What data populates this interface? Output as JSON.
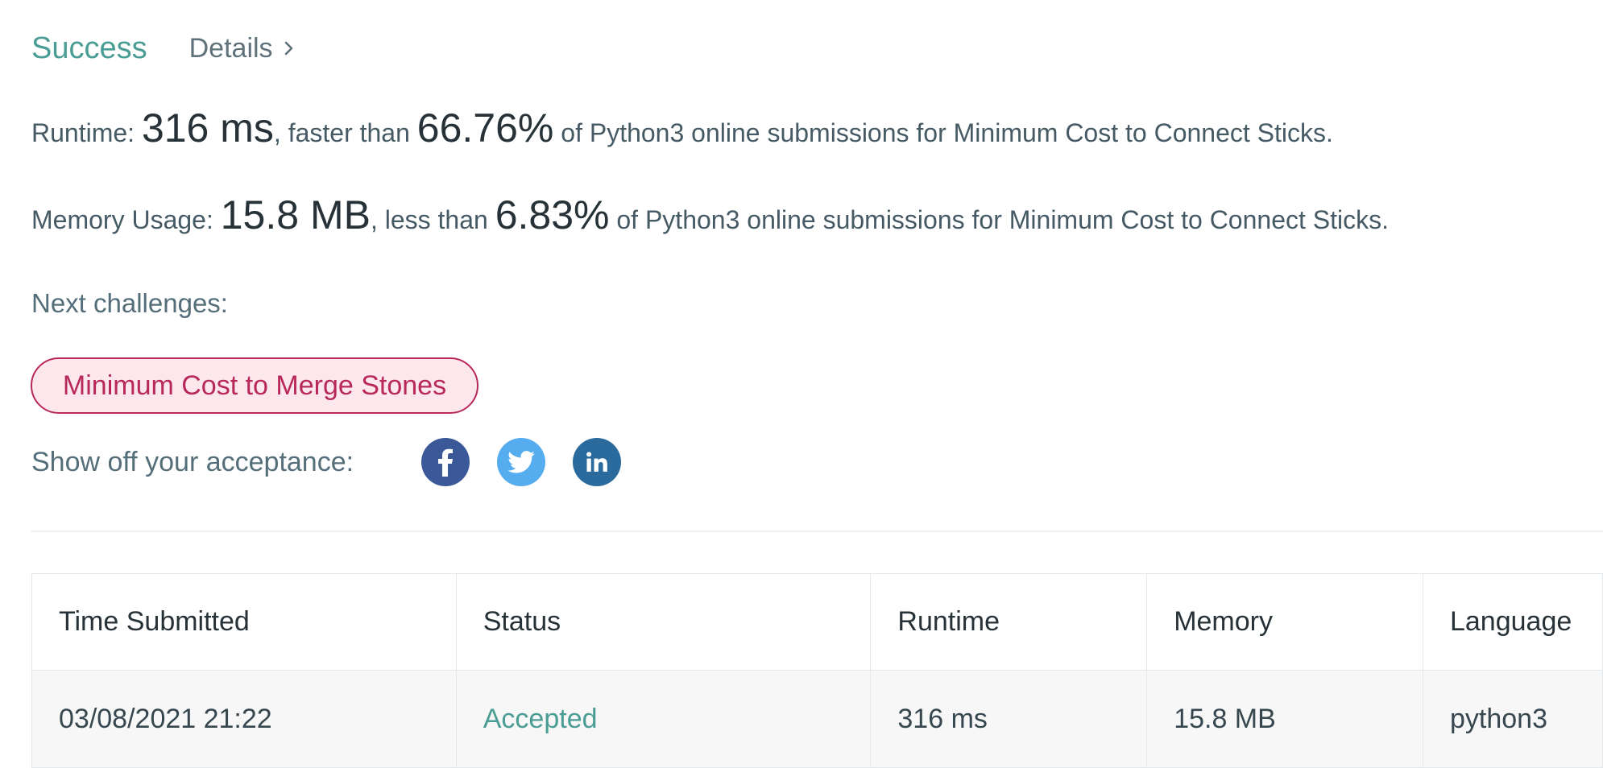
{
  "colors": {
    "success": "#4a9d94",
    "pill_border": "#b8285a",
    "pill_bg": "#fbe7ec",
    "pill_text": "#b8285a",
    "facebook": "#3b5998",
    "twitter": "#55acee",
    "linkedin": "#2a6a9c"
  },
  "header": {
    "title": "Success",
    "details_label": "Details",
    "details_icon": "chevron-right-icon"
  },
  "runtime": {
    "prefix": "Runtime: ",
    "value": "316 ms",
    "middle": ", faster than ",
    "percent": "66.76%",
    "suffix": " of Python3 online submissions for Minimum Cost to Connect Sticks."
  },
  "memory": {
    "prefix": "Memory Usage: ",
    "value": "15.8 MB",
    "middle": ", less than ",
    "percent": "6.83%",
    "suffix": " of Python3 online submissions for Minimum Cost to Connect Sticks."
  },
  "next": {
    "label": "Next challenges:",
    "challenges": [
      "Minimum Cost to Merge Stones"
    ]
  },
  "share": {
    "label": "Show off your acceptance:",
    "icons": [
      "facebook-icon",
      "twitter-icon",
      "linkedin-icon"
    ]
  },
  "table": {
    "headers": [
      "Time Submitted",
      "Status",
      "Runtime",
      "Memory",
      "Language"
    ],
    "rows": [
      [
        "03/08/2021 21:22",
        "Accepted",
        "316 ms",
        "15.8 MB",
        "python3"
      ]
    ]
  }
}
